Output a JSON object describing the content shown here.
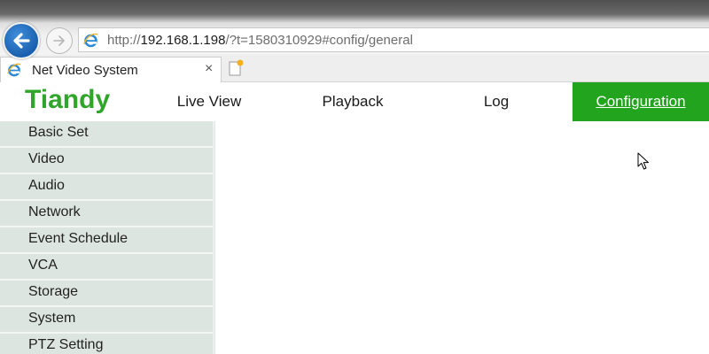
{
  "browser": {
    "url_prefix": "http://",
    "url_host": "192.168.1.198",
    "url_path": "/?t=1580310929#config/general",
    "back_icon": "back-arrow-icon",
    "forward_icon": "forward-arrow-icon",
    "tab": {
      "title": "Net Video System",
      "close_glyph": "×"
    }
  },
  "header": {
    "logo": "Tiandy",
    "nav": [
      {
        "label": "Live View"
      },
      {
        "label": "Playback"
      },
      {
        "label": "Log"
      },
      {
        "label": "Configuration",
        "active": true
      }
    ]
  },
  "sidebar": {
    "items": [
      {
        "label": "Basic Set"
      },
      {
        "label": "Video"
      },
      {
        "label": "Audio"
      },
      {
        "label": "Network"
      },
      {
        "label": "Event Schedule"
      },
      {
        "label": "VCA"
      },
      {
        "label": "Storage"
      },
      {
        "label": "System"
      },
      {
        "label": "PTZ Setting"
      }
    ]
  },
  "colors": {
    "brand_green": "#2fa52a",
    "active_nav_bg": "#23a41e",
    "menu_item_bg": "#dde5e0",
    "browser_back_blue": "#1a5fae"
  }
}
